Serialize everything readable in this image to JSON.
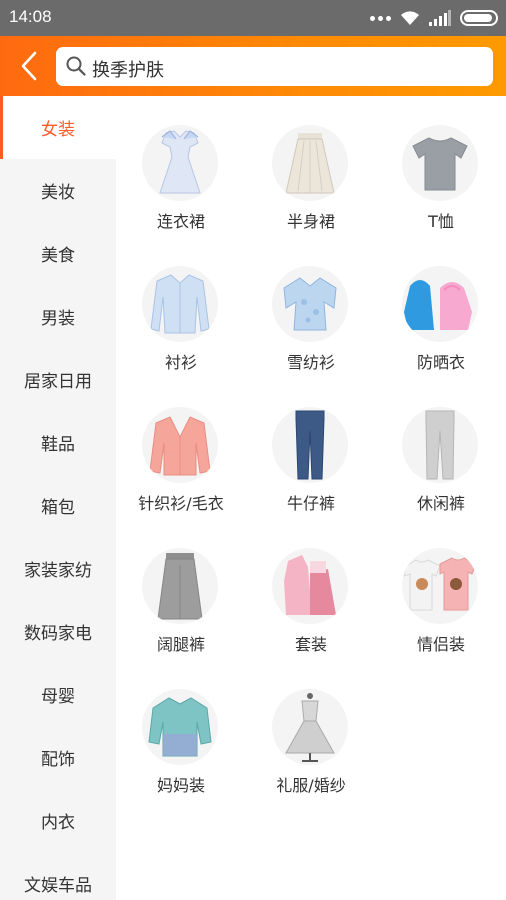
{
  "status_bar": {
    "time": "14:08"
  },
  "header": {
    "search_placeholder": "换季护肤"
  },
  "sidebar": {
    "items": [
      "女装",
      "美妆",
      "美食",
      "男装",
      "居家日用",
      "鞋品",
      "箱包",
      "家装家纺",
      "数码家电",
      "母婴",
      "配饰",
      "内衣",
      "文娱车品"
    ],
    "active_index": 0
  },
  "grid": {
    "items": [
      {
        "label": "连衣裙",
        "icon": "dress-icon"
      },
      {
        "label": "半身裙",
        "icon": "skirt-icon"
      },
      {
        "label": "T恤",
        "icon": "tshirt-icon"
      },
      {
        "label": "衬衫",
        "icon": "shirt-icon"
      },
      {
        "label": "雪纺衫",
        "icon": "chiffon-blouse-icon"
      },
      {
        "label": "防晒衣",
        "icon": "sun-jacket-icon"
      },
      {
        "label": "针织衫/毛衣",
        "icon": "cardigan-icon"
      },
      {
        "label": "牛仔裤",
        "icon": "jeans-icon"
      },
      {
        "label": "休闲裤",
        "icon": "casual-pants-icon"
      },
      {
        "label": "阔腿裤",
        "icon": "wide-leg-pants-icon"
      },
      {
        "label": "套装",
        "icon": "outfit-set-icon"
      },
      {
        "label": "情侣装",
        "icon": "couple-tees-icon"
      },
      {
        "label": "妈妈装",
        "icon": "mom-blouse-icon"
      },
      {
        "label": "礼服/婚纱",
        "icon": "gown-icon"
      }
    ]
  }
}
